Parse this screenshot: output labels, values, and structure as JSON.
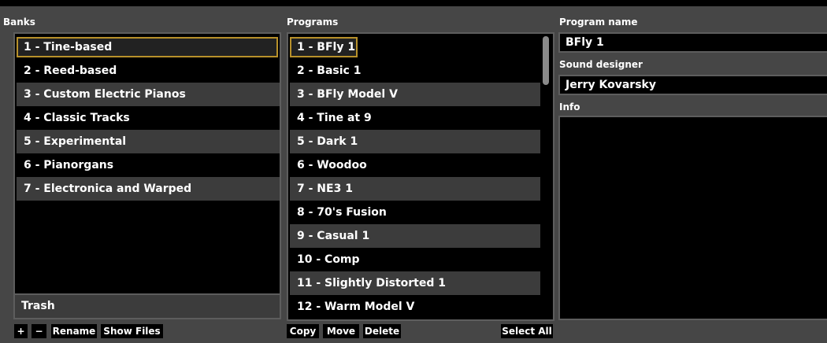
{
  "banks": {
    "title": "Banks",
    "items": [
      {
        "label": "1 - Tine-based"
      },
      {
        "label": "2 - Reed-based"
      },
      {
        "label": "3 - Custom Electric Pianos"
      },
      {
        "label": "4 - Classic Tracks"
      },
      {
        "label": "5 - Experimental"
      },
      {
        "label": "6 - Pianorgans"
      },
      {
        "label": "7 - Electronica and Warped"
      }
    ],
    "selected_index": 0,
    "trash_label": "Trash",
    "buttons": {
      "add": "+",
      "remove": "−",
      "rename": "Rename",
      "show_files": "Show Files"
    }
  },
  "programs": {
    "title": "Programs",
    "items": [
      {
        "label": "1 - BFly 1"
      },
      {
        "label": "2 - Basic 1"
      },
      {
        "label": "3 - BFly Model V"
      },
      {
        "label": "4 - Tine at 9"
      },
      {
        "label": "5 - Dark 1"
      },
      {
        "label": "6 - Woodoo"
      },
      {
        "label": "7 - NE3 1"
      },
      {
        "label": "8 - 70's Fusion"
      },
      {
        "label": "9 - Casual 1"
      },
      {
        "label": "10 - Comp"
      },
      {
        "label": "11 - Slightly Distorted 1"
      },
      {
        "label": "12 - Warm Model V"
      }
    ],
    "selected_index": 0,
    "buttons": {
      "copy": "Copy",
      "move": "Move",
      "delete": "Delete",
      "select_all": "Select All"
    }
  },
  "details": {
    "program_name_label": "Program name",
    "program_name_value": "BFly 1",
    "sound_designer_label": "Sound designer",
    "sound_designer_value": "Jerry Kovarsky",
    "info_label": "Info",
    "info_value": ""
  },
  "colors": {
    "background": "#464646",
    "list_bg": "#000000",
    "row_alt": "#3c3c3c",
    "selection_border": "#b8912a"
  }
}
